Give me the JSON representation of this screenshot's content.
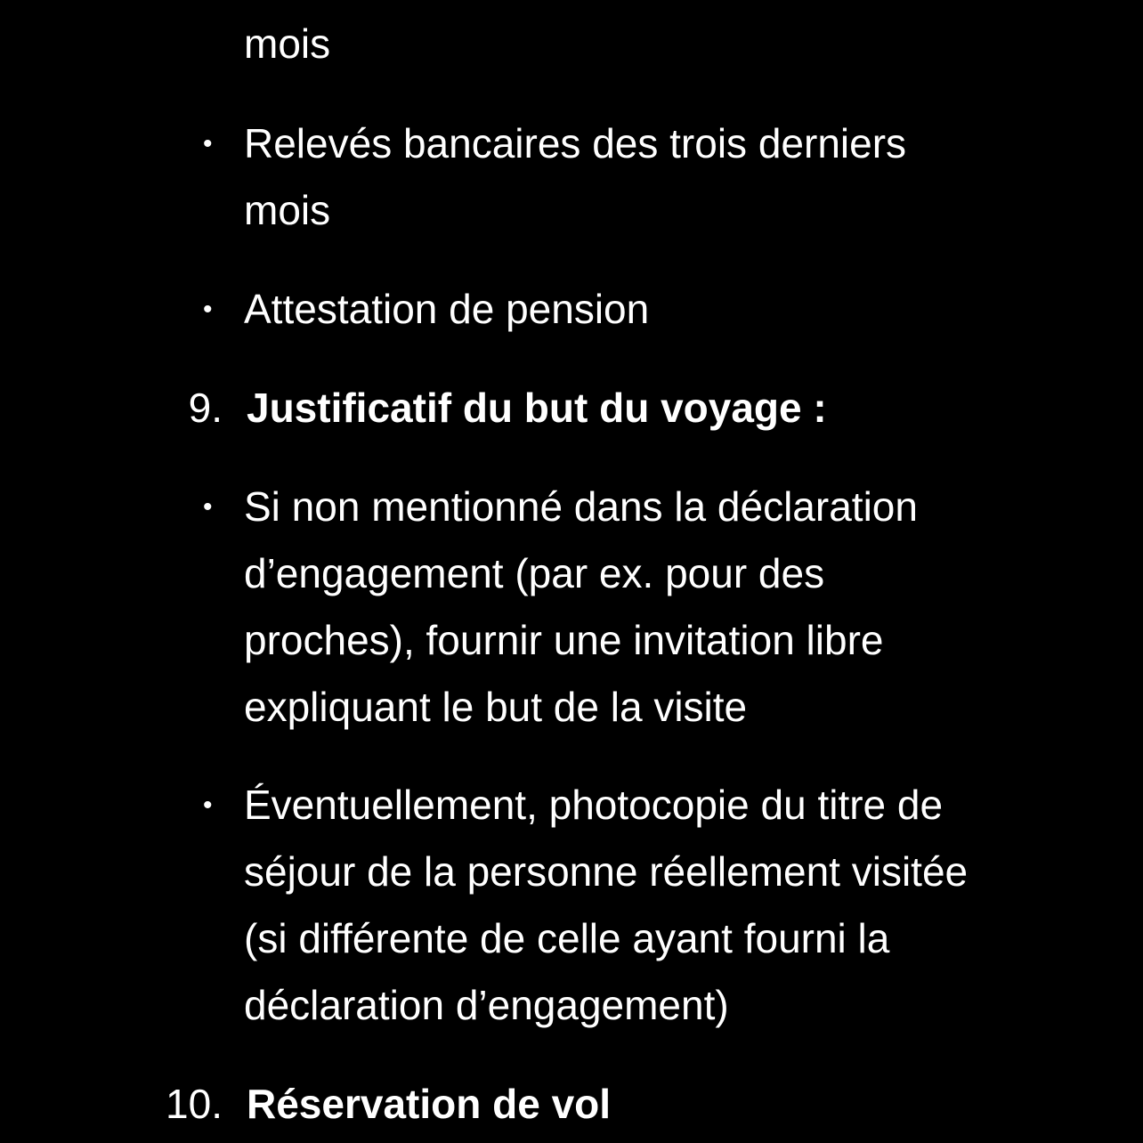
{
  "list": {
    "prev_bullet_tail": "mois",
    "bullets_before": [
      {
        "bullet": "•",
        "lines": [
          "Relevés bancaires des trois derniers",
          "mois"
        ]
      },
      {
        "bullet": "•",
        "lines": [
          "Attestation de pension"
        ]
      }
    ],
    "item9": {
      "number": "9.",
      "title": "Justificatif du but du voyage :",
      "bullets": [
        {
          "bullet": "•",
          "lines": [
            "Si non mentionné dans la déclaration",
            "d’engagement (par ex. pour des",
            "proches), fournir une invitation libre",
            "expliquant le but de la visite"
          ]
        },
        {
          "bullet": "•",
          "lines": [
            "Éventuellement, photocopie du titre de",
            "séjour de la personne réellement visitée",
            "(si différente de celle ayant fourni la",
            "déclaration d’engagement)"
          ]
        }
      ]
    },
    "item10": {
      "number": "10.",
      "title": "Réservation de vol"
    }
  },
  "colors": {
    "background": "#000000",
    "text": "#ffffff"
  }
}
